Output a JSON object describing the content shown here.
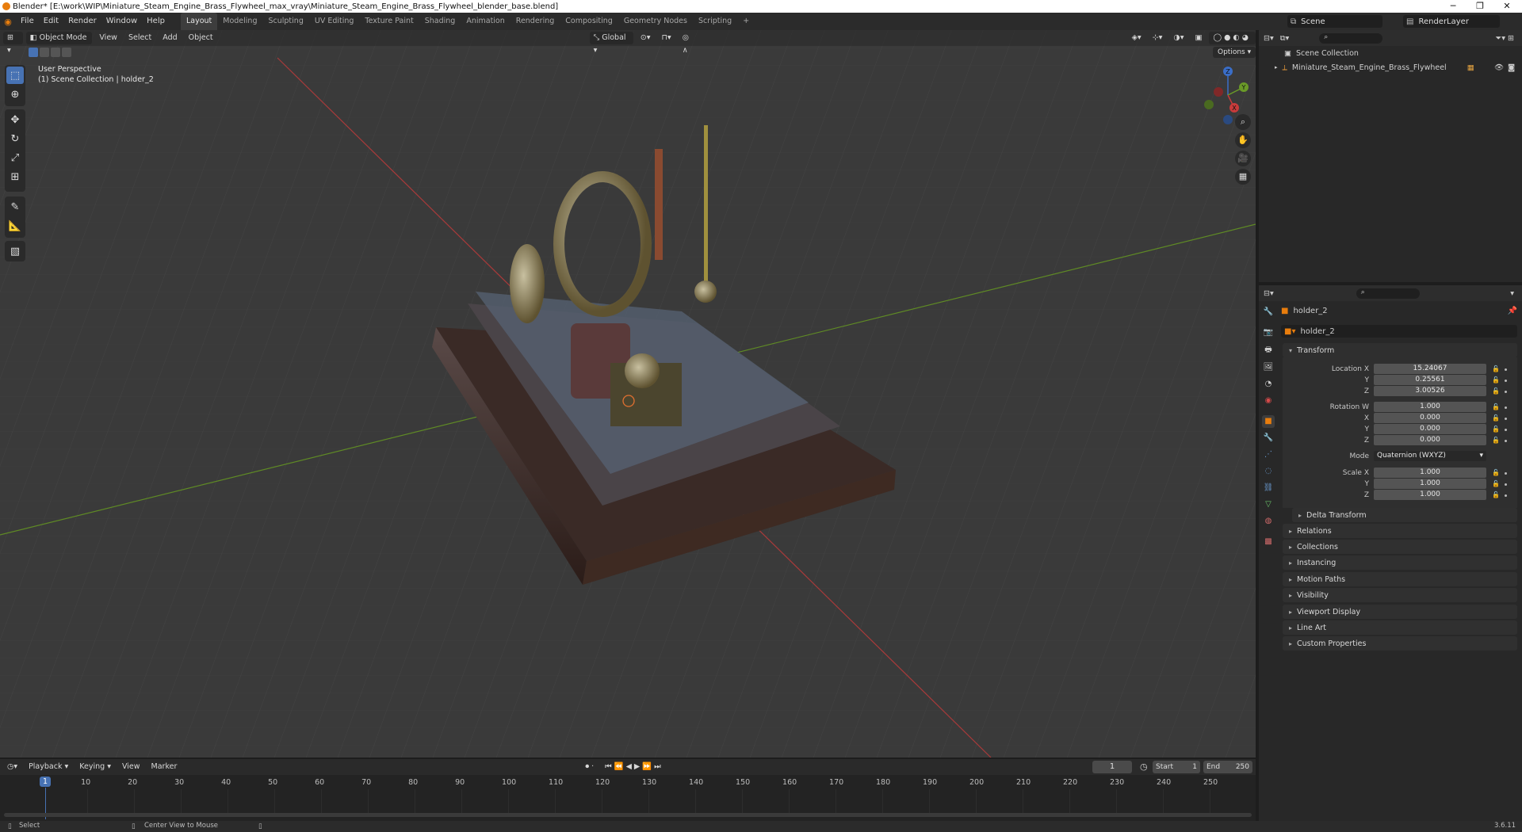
{
  "window": {
    "title": "Blender* [E:\\work\\WIP\\Miniature_Steam_Engine_Brass_Flywheel_max_vray\\Miniature_Steam_Engine_Brass_Flywheel_blender_base.blend]",
    "min": "─",
    "max": "❐",
    "close": "✕"
  },
  "menus": [
    "File",
    "Edit",
    "Render",
    "Window",
    "Help"
  ],
  "workspaces": [
    "Layout",
    "Modeling",
    "Sculpting",
    "UV Editing",
    "Texture Paint",
    "Shading",
    "Animation",
    "Rendering",
    "Compositing",
    "Geometry Nodes",
    "Scripting",
    "+"
  ],
  "active_workspace": "Layout",
  "scene": {
    "name": "Scene",
    "render_layer": "RenderLayer"
  },
  "viewport": {
    "mode": "Object Mode",
    "menus": [
      "View",
      "Select",
      "Add",
      "Object"
    ],
    "orientation": "Global",
    "options": "Options",
    "overlay_title": "User Perspective",
    "overlay_sub": "(1) Scene Collection | holder_2",
    "gizmo": {
      "x": "X",
      "y": "Y",
      "z": "Z"
    }
  },
  "outliner": {
    "root": "Scene Collection",
    "items": [
      "Miniature_Steam_Engine_Brass_Flywheel"
    ]
  },
  "properties": {
    "object_name": "holder_2",
    "data_name": "holder_2",
    "transform_title": "Transform",
    "location": {
      "label": "Location X",
      "x": "15.24067",
      "y": "0.25561",
      "z": "3.00526"
    },
    "rotation": {
      "label": "Rotation W",
      "w": "1.000",
      "x": "0.000",
      "y": "0.000",
      "z": "0.000"
    },
    "mode_label": "Mode",
    "mode_value": "Quaternion (WXYZ)",
    "scale": {
      "label": "Scale X",
      "x": "1.000",
      "y": "1.000",
      "z": "1.000"
    },
    "axis": {
      "x": "X",
      "y": "Y",
      "z": "Z"
    },
    "delta": "Delta Transform",
    "sections": [
      "Relations",
      "Collections",
      "Instancing",
      "Motion Paths",
      "Visibility",
      "Viewport Display",
      "Line Art",
      "Custom Properties"
    ]
  },
  "timeline": {
    "menus": [
      "Playback",
      "Keying",
      "View",
      "Marker"
    ],
    "current_frame": "1",
    "start_label": "Start",
    "start": "1",
    "end_label": "End",
    "end": "250",
    "ticks": [
      "1",
      "10",
      "20",
      "30",
      "40",
      "50",
      "60",
      "70",
      "80",
      "90",
      "100",
      "110",
      "120",
      "130",
      "140",
      "150",
      "160",
      "170",
      "180",
      "190",
      "200",
      "210",
      "220",
      "230",
      "240",
      "250"
    ]
  },
  "status": {
    "left": "Select",
    "middle": "Center View to Mouse",
    "version": "3.6.11"
  },
  "colors": {
    "accent": "#4772b3",
    "x_axis": "#c83b3b",
    "y_axis": "#6a9a28"
  }
}
